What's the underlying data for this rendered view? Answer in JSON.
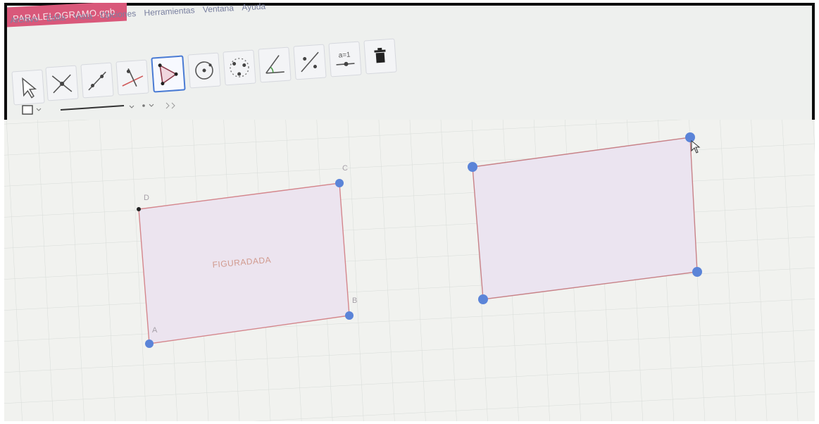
{
  "window": {
    "title": "PARALELOGRAMO.ggb"
  },
  "menu": {
    "items": [
      "Archivo",
      "Edita",
      "Vista",
      "Opciones",
      "Herramientas",
      "Ventana",
      "Ayuda"
    ]
  },
  "toolbar": {
    "tools": [
      {
        "name": "move-tool",
        "icon": "cursor-arrow-icon"
      },
      {
        "name": "point-tool",
        "icon": "intersect-point-icon"
      },
      {
        "name": "line-tool",
        "icon": "line-icon"
      },
      {
        "name": "perpendicular-tool",
        "icon": "perpendicular-line-icon"
      },
      {
        "name": "polygon-tool",
        "icon": "polygon-icon",
        "selected": true
      },
      {
        "name": "circle-tool",
        "icon": "circle-center-icon"
      },
      {
        "name": "conic-tool",
        "icon": "conic-icon"
      },
      {
        "name": "angle-tool",
        "icon": "angle-icon"
      },
      {
        "name": "reflect-tool",
        "icon": "reflect-point-icon"
      },
      {
        "name": "slider-tool",
        "icon": "slider-icon",
        "label": "a=1"
      },
      {
        "name": "delete-tool",
        "icon": "trash-icon"
      }
    ]
  },
  "stylebar": {
    "icons": [
      "square-outline-icon",
      "line-style-icon",
      "point-style-icon",
      "collapse-icon"
    ]
  },
  "canvas": {
    "left_shape": {
      "caption": "FIGURADADA",
      "points": [
        "A",
        "B",
        "C",
        "D"
      ]
    },
    "right_shape": {
      "points": []
    }
  },
  "colors": {
    "accent": "#4a7bd4",
    "point": "#5b84d8",
    "edge": "#d4868c",
    "fill": "#ece4ef",
    "title_bar": "#d9587a"
  }
}
